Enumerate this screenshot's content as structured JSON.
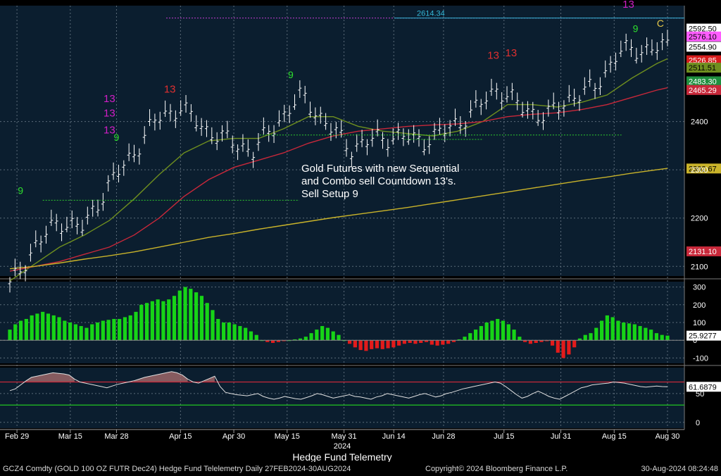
{
  "chart_data": [
    {
      "type": "line",
      "panel": "price",
      "instrument": "GCZ4 Comdty (GOLD 100 OZ FUTR  Dec24) Hedge Fund Telelemetry",
      "annotation": [
        "Gold Futures with new Sequential",
        "and Combo sell Countdown 13's.",
        "Sell Setup 9"
      ],
      "ylim": [
        2080,
        2640
      ],
      "y_ticks": [
        2100,
        2200,
        2300,
        2400
      ],
      "grid": false,
      "x": [
        "2024-02-27",
        "2024-03-05",
        "2024-03-12",
        "2024-03-19",
        "2024-03-26",
        "2024-04-02",
        "2024-04-09",
        "2024-04-16",
        "2024-04-23",
        "2024-04-30",
        "2024-05-07",
        "2024-05-14",
        "2024-05-21",
        "2024-05-28",
        "2024-06-04",
        "2024-06-11",
        "2024-06-18",
        "2024-06-25",
        "2024-07-02",
        "2024-07-09",
        "2024-07-16",
        "2024-07-23",
        "2024-07-30",
        "2024-08-06",
        "2024-08-13",
        "2024-08-20",
        "2024-08-27",
        "2024-08-30"
      ],
      "series": [
        {
          "role": "close",
          "color": "#ffffff",
          "values": [
            2060,
            2140,
            2195,
            2180,
            2265,
            2330,
            2405,
            2430,
            2385,
            2360,
            2340,
            2400,
            2455,
            2395,
            2345,
            2365,
            2370,
            2360,
            2385,
            2420,
            2470,
            2430,
            2410,
            2450,
            2470,
            2545,
            2550,
            2555
          ]
        },
        {
          "role": "short-ma",
          "color": "#6f8f1f",
          "values": [
            2070,
            2105,
            2140,
            2165,
            2195,
            2240,
            2290,
            2335,
            2360,
            2365,
            2365,
            2385,
            2410,
            2410,
            2390,
            2380,
            2375,
            2370,
            2380,
            2400,
            2435,
            2435,
            2430,
            2440,
            2455,
            2490,
            2520,
            2530
          ]
        },
        {
          "role": "mid-ma",
          "color": "#c8283a",
          "values": [
            2090,
            2100,
            2110,
            2125,
            2140,
            2165,
            2200,
            2245,
            2280,
            2305,
            2320,
            2335,
            2355,
            2370,
            2380,
            2385,
            2390,
            2393,
            2395,
            2400,
            2410,
            2415,
            2418,
            2425,
            2435,
            2450,
            2465,
            2470
          ]
        },
        {
          "role": "long-ma",
          "color": "#c9b32a",
          "values": [
            2095,
            2100,
            2107,
            2115,
            2122,
            2130,
            2140,
            2150,
            2160,
            2168,
            2177,
            2185,
            2193,
            2201,
            2208,
            2215,
            2222,
            2230,
            2238,
            2246,
            2254,
            2262,
            2270,
            2278,
            2285,
            2293,
            2300,
            2303
          ]
        }
      ],
      "price_labels": [
        {
          "text": "2614.34",
          "value": 2614.34,
          "color": "#34b6d6"
        },
        {
          "text": "2592.50",
          "value": 2592.5,
          "color": "#ffffff"
        },
        {
          "text": "2576.10",
          "value": 2576.1,
          "color": "#ff5cff"
        },
        {
          "text": "2554.90",
          "value": 2554.9,
          "color": "#ffffff"
        },
        {
          "text": "2526.85",
          "value": 2526.85,
          "color": "#d61c1c"
        },
        {
          "text": "2511.51",
          "value": 2511.51,
          "color": "#6f8f1f"
        },
        {
          "text": "2483.30",
          "value": 2483.3,
          "color": "#1f8f3f"
        },
        {
          "text": "2465.29",
          "value": 2465.29,
          "color": "#c8283a"
        },
        {
          "text": "2302.67",
          "value": 2302.67,
          "color": "#c9b32a"
        },
        {
          "text": "2131.10",
          "value": 2131.1,
          "color": "#c8283a"
        }
      ],
      "counts": [
        {
          "x": "2024-03-01",
          "text": "9",
          "color": "#2ee02e",
          "above": 2250
        },
        {
          "x": "2024-03-26",
          "text": "13",
          "color": "#d21ec6",
          "above": 2440
        },
        {
          "x": "2024-03-26",
          "text": "13",
          "color": "#d21ec6",
          "above": 2410
        },
        {
          "x": "2024-03-26",
          "text": "13",
          "color": "#d21ec6",
          "above": 2375
        },
        {
          "x": "2024-03-28",
          "text": "9",
          "color": "#2ee02e",
          "above": 2360
        },
        {
          "x": "2024-04-12",
          "text": "13",
          "color": "#e03030",
          "above": 2460
        },
        {
          "x": "2024-05-16",
          "text": "9",
          "color": "#2ee02e",
          "above": 2490
        },
        {
          "x": "2024-07-12",
          "text": "13",
          "color": "#e03030",
          "above": 2530
        },
        {
          "x": "2024-07-17",
          "text": "13",
          "color": "#e03030",
          "above": 2535
        },
        {
          "x": "2024-08-19",
          "text": "13",
          "color": "#d21ec6",
          "above": 2636
        },
        {
          "x": "2024-08-21",
          "text": "9",
          "color": "#2ee02e",
          "above": 2585
        },
        {
          "x": "2024-08-28",
          "text": "C",
          "color": "#e6c84a",
          "above": 2596
        }
      ]
    },
    {
      "type": "bar",
      "panel": "oscillator",
      "ylim": [
        -130,
        330
      ],
      "y_ticks": [
        -100,
        0,
        100,
        200,
        300
      ],
      "last_value_label": "25.9277",
      "last_value": 25.9277,
      "positive_color": "#17d417",
      "negative_color": "#e31b1b",
      "values": [
        60,
        90,
        110,
        120,
        140,
        150,
        160,
        150,
        140,
        130,
        110,
        100,
        90,
        80,
        70,
        90,
        100,
        110,
        115,
        120,
        120,
        130,
        140,
        160,
        200,
        210,
        220,
        230,
        220,
        230,
        250,
        280,
        300,
        290,
        270,
        250,
        210,
        170,
        120,
        100,
        100,
        90,
        80,
        70,
        50,
        30,
        0,
        -10,
        -15,
        -10,
        -5,
        0,
        5,
        10,
        20,
        40,
        60,
        80,
        70,
        50,
        30,
        0,
        -20,
        -40,
        -55,
        -60,
        -50,
        -45,
        -50,
        -45,
        -40,
        -30,
        -20,
        -15,
        -20,
        -15,
        -10,
        -25,
        -30,
        -25,
        -20,
        -10,
        5,
        20,
        40,
        60,
        80,
        100,
        110,
        120,
        110,
        90,
        60,
        20,
        -10,
        -20,
        -15,
        -10,
        -5,
        -30,
        -70,
        -100,
        -80,
        -40,
        10,
        30,
        40,
        70,
        110,
        140,
        130,
        110,
        100,
        95,
        90,
        80,
        70,
        60,
        40,
        30,
        26
      ]
    },
    {
      "type": "line",
      "panel": "rsi",
      "ylim": [
        -10,
        95
      ],
      "y_ticks": [
        0,
        50
      ],
      "upper": 70,
      "lower": 30,
      "last_value_label": "61.6879",
      "last_value": 61.6879,
      "color": "#e0e0e0",
      "upper_color": "#c8283a",
      "lower_color": "#22c422",
      "values": [
        55,
        58,
        65,
        72,
        78,
        80,
        82,
        84,
        86,
        85,
        84,
        82,
        75,
        70,
        68,
        66,
        64,
        62,
        60,
        63,
        66,
        68,
        70,
        72,
        75,
        78,
        80,
        82,
        84,
        86,
        88,
        86,
        82,
        75,
        70,
        68,
        72,
        76,
        80,
        62,
        52,
        50,
        48,
        47,
        46,
        48,
        50,
        45,
        42,
        40,
        42,
        45,
        43,
        41,
        40,
        43,
        46,
        50,
        48,
        45,
        42,
        44,
        46,
        48,
        45,
        44,
        42,
        40,
        44,
        46,
        50,
        48,
        46,
        44,
        42,
        45,
        48,
        50,
        47,
        44,
        46,
        50,
        52,
        55,
        58,
        60,
        62,
        64,
        66,
        68,
        70,
        68,
        62,
        55,
        48,
        42,
        45,
        50,
        54,
        50,
        45,
        42,
        40,
        45,
        50,
        55,
        60,
        62,
        65,
        66,
        67,
        68,
        70,
        69,
        68,
        66,
        64,
        62,
        61,
        62,
        63,
        62,
        61.7
      ]
    }
  ],
  "axis": {
    "x_ticks": [
      "Feb 29",
      "Mar 15",
      "Mar 28",
      "Apr 15",
      "Apr 30",
      "May 15",
      "May 31",
      "Jun 14",
      "Jun 28",
      "Jul 15",
      "Jul 31",
      "Aug 15",
      "Aug 30"
    ],
    "year": "2024",
    "title": "Hedge Fund Telemetry"
  },
  "footer": {
    "left": "GCZ4 Comdty (GOLD 100 OZ FUTR  Dec24) Hedge Fund Telelemetry  Daily 27FEB2024-30AUG2024",
    "middle": "Copyright© 2024 Bloomberg Finance L.P.",
    "right": "30-Aug-2024 08:24:48"
  }
}
